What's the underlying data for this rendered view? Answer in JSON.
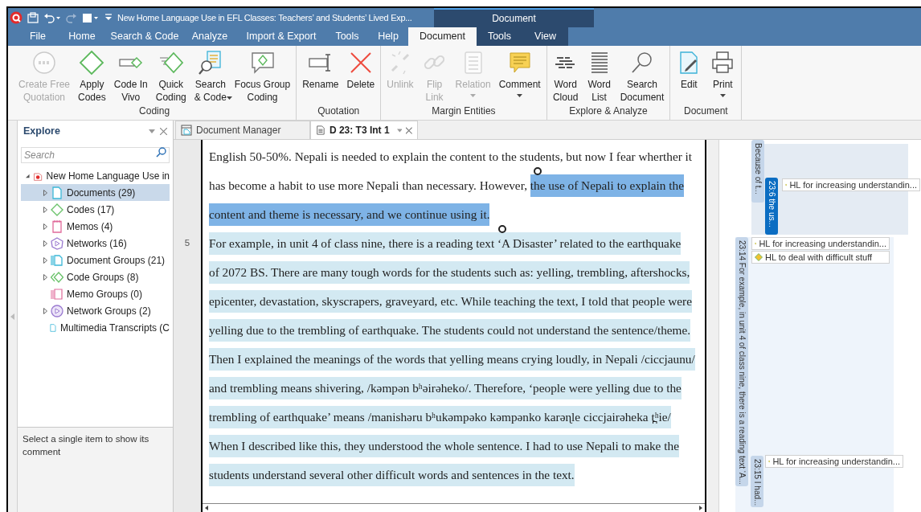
{
  "title_bar": {
    "title": "New Home Language Use in EFL Classes: Teachers’ and Students’ Lived Exp...",
    "context_label": "Document"
  },
  "menu_tabs": [
    {
      "label": "File",
      "selected": false,
      "contextual": false
    },
    {
      "label": "Home",
      "selected": false,
      "contextual": false
    },
    {
      "label": "Search & Code",
      "selected": false,
      "contextual": false
    },
    {
      "label": "Analyze",
      "selected": false,
      "contextual": false
    },
    {
      "label": "Import & Export",
      "selected": false,
      "contextual": false
    },
    {
      "label": "Tools",
      "selected": false,
      "contextual": false
    },
    {
      "label": "Help",
      "selected": false,
      "contextual": false
    },
    {
      "label": "Document",
      "selected": true,
      "contextual": true
    },
    {
      "label": "Tools",
      "selected": false,
      "contextual": true
    },
    {
      "label": "View",
      "selected": false,
      "contextual": true
    }
  ],
  "ribbon": [
    {
      "label": "Coding",
      "buttons": [
        {
          "label": "Create Free\nQuotation",
          "disabled": true,
          "dropdown": false
        },
        {
          "label": "Apply\nCodes",
          "disabled": false,
          "dropdown": false
        },
        {
          "label": "Code In\nVivo",
          "disabled": false,
          "dropdown": false
        },
        {
          "label": "Quick\nCoding",
          "disabled": false,
          "dropdown": false
        },
        {
          "label": "Search\n& Code",
          "disabled": false,
          "dropdown": true
        },
        {
          "label": "Focus Group\nCoding",
          "disabled": false,
          "dropdown": false
        }
      ]
    },
    {
      "label": "Quotation",
      "buttons": [
        {
          "label": "Rename",
          "disabled": false,
          "dropdown": false
        },
        {
          "label": "Delete",
          "disabled": false,
          "dropdown": false
        }
      ]
    },
    {
      "label": "Margin Entities",
      "buttons": [
        {
          "label": "Unlink",
          "disabled": true,
          "dropdown": false
        },
        {
          "label": "Flip\nLink",
          "disabled": true,
          "dropdown": false
        },
        {
          "label": "Relation",
          "disabled": true,
          "dropdown": true
        },
        {
          "label": "Comment",
          "disabled": false,
          "dropdown": true
        }
      ]
    },
    {
      "label": "Explore & Analyze",
      "buttons": [
        {
          "label": "Word\nCloud",
          "disabled": false,
          "dropdown": false
        },
        {
          "label": "Word\nList",
          "disabled": false,
          "dropdown": false
        },
        {
          "label": "Search\nDocument",
          "disabled": false,
          "dropdown": false
        }
      ]
    },
    {
      "label": "Document",
      "buttons": [
        {
          "label": "Edit",
          "disabled": false,
          "dropdown": false
        },
        {
          "label": "Print",
          "disabled": false,
          "dropdown": true
        }
      ]
    }
  ],
  "explore": {
    "title": "Explore",
    "search_placeholder": "Search",
    "root": {
      "label": "New Home Language Use in",
      "expanded": true,
      "children": [
        {
          "label": "Documents (29)",
          "kind": "document",
          "expandable": true,
          "selected": true
        },
        {
          "label": "Codes (17)",
          "kind": "code",
          "expandable": true,
          "selected": false
        },
        {
          "label": "Memos (4)",
          "kind": "memo",
          "expandable": true,
          "selected": false
        },
        {
          "label": "Networks (16)",
          "kind": "network",
          "expandable": true,
          "selected": false
        },
        {
          "label": "Document Groups (21)",
          "kind": "document-group",
          "expandable": true,
          "selected": false
        },
        {
          "label": "Code Groups (8)",
          "kind": "code-group",
          "expandable": true,
          "selected": false
        },
        {
          "label": "Memo Groups (0)",
          "kind": "memo-group",
          "expandable": false,
          "selected": false
        },
        {
          "label": "Network Groups (2)",
          "kind": "network-group",
          "expandable": true,
          "selected": false
        },
        {
          "label": "Multimedia Transcripts (C",
          "kind": "transcript",
          "expandable": false,
          "selected": false
        }
      ]
    },
    "comment": "Select a single item to show its comment"
  },
  "doc_tabs": [
    {
      "label": "Document Manager",
      "selected": false
    },
    {
      "label": "D 23: T3 Int 1",
      "selected": true
    }
  ],
  "document": {
    "lines": [
      {
        "segments": [
          {
            "text": "English 50-50%. Nepali is needed to explain the content to the students, but now I fear wherther it",
            "selected": false,
            "coded": false
          }
        ]
      },
      {
        "segments": [
          {
            "text": "has become a habit to use more Nepali than necessary. However, ",
            "selected": false,
            "coded": false
          },
          {
            "text": "the use of Nepali to explain the",
            "selected": true,
            "coded": true
          }
        ]
      },
      {
        "segments": [
          {
            "text": "content and theme is necessary, and we continue using it.",
            "selected": true,
            "coded": true
          }
        ]
      },
      {
        "number": "5",
        "segments": [
          {
            "text": "For example, in unit 4 of class nine, there is a reading text ‘A Disaster’ related to the earthquake",
            "selected": false,
            "coded": true
          }
        ]
      },
      {
        "segments": [
          {
            "text": "of 2072 BS. There are many tough words for the students such as: yelling, trembling, aftershocks,",
            "selected": false,
            "coded": true
          }
        ]
      },
      {
        "segments": [
          {
            "text": "epicenter, devastation, skyscrapers, graveyard, etc. While teaching the text, I told that people were",
            "selected": false,
            "coded": true
          }
        ]
      },
      {
        "segments": [
          {
            "text": "yelling due to the trembling of earthquake. The students could not understand the sentence/theme.",
            "selected": false,
            "coded": true
          }
        ]
      },
      {
        "segments": [
          {
            "text": "Then I explained the meanings of the words that yelling means crying loudly, in Nepali /ciccjaunu/",
            "selected": false,
            "coded": true
          }
        ]
      },
      {
        "segments": [
          {
            "text": "and trembling means shivering, /kəmpən bʰəirəheko/. Therefore, ‘people were yelling due to the",
            "selected": false,
            "coded": true
          }
        ]
      },
      {
        "segments": [
          {
            "text": "trembling of earthquake’ means /manishəru bʰukəmpəko kəmpənko karəɳle ciccjairəheka t̪ʰie/",
            "selected": false,
            "coded": true
          }
        ]
      },
      {
        "segments": [
          {
            "text": "When I described like this, they understood the whole sentence. I had to use Nepali to make the",
            "selected": false,
            "coded": true
          }
        ]
      },
      {
        "segments": [
          {
            "text": "students understand several other difficult words and sentences in the text.",
            "selected": false,
            "coded": true
          }
        ]
      }
    ]
  },
  "margin": {
    "quotations": [
      {
        "label": "Because of t...",
        "selected": false
      },
      {
        "label": "23:6 the us...",
        "selected": true,
        "codes": [
          "HL for increasing understandin..."
        ]
      },
      {
        "label": "23:14 For example, in unit 4 of class nine, there is a reading text ‘A...",
        "selected": false,
        "codes": [
          "HL for increasing understandin...",
          "HL to deal with difficult stuff"
        ]
      },
      {
        "label": "23:15 I had...",
        "selected": false,
        "codes": [
          "HL for increasing understandin..."
        ]
      }
    ]
  }
}
